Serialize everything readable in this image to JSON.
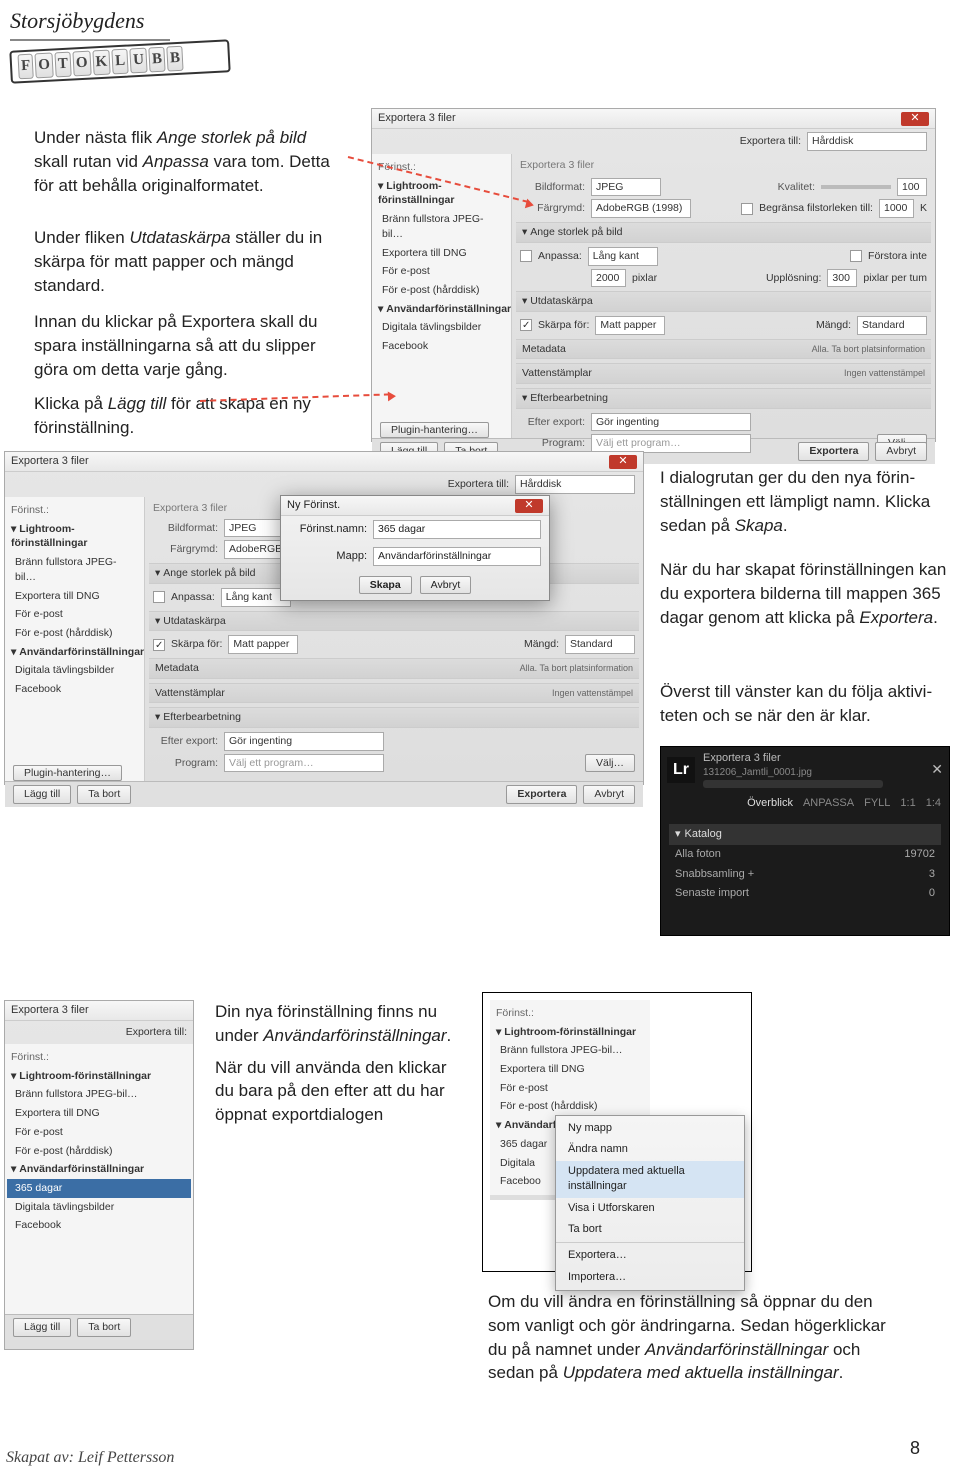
{
  "logo": {
    "name": "Storsjöbygdens",
    "sub": "FOTOKLUBB"
  },
  "para1_l1": "Under nästa flik ",
  "para1_i1": "Ange storlek på bild",
  "para1_l2": " skall rutan vid ",
  "para1_i2": "Anpassa",
  "para1_l3": " vara tom. Detta för att behålla originalforma­tet.",
  "para2_l1": "Under fliken ",
  "para2_i1": "Utdataskärpa",
  "para2_l2": " ställer du in skärpa för matt papper och mängd standard.",
  "para3": "Innan du klickar på Exportera skall du spara inställningarna så att du slipper göra om detta varje gång.",
  "para4_l1": "Klicka på ",
  "para4_i1": "Lägg till",
  "para4_l2": " för att skapa en ny förinställning.",
  "para5_l1": "I dialogrutan ger du den nya förin­ställningen ett lämpligt namn. Klicka sedan på ",
  "para5_i1": "Skapa",
  "para5_l2": ".",
  "para6_l1": "När du har skapat förinställningen kan du exportera bilderna till map­pen 365 dagar genom att klicka på ",
  "para6_i1": "Exportera",
  "para6_l2": ".",
  "para7": "Överst till vänster kan du följa aktivi­teten och se när den är klar.",
  "para8_l1": "Din nya förinställning finns nu under ",
  "para8_i1": "Användarförin­ställningar",
  "para8_l2": ".",
  "para8_l3": "När du vill använda den klickar du bara på den efter att du har öppnat export­dialogen",
  "para9_l1": "Om du vill ändra en förinställning så öppnar du den som vanligt och gör ändringarna. Sedan hö­gerklickar du på namnet under ",
  "para9_i1": "Användarförin­ställningar",
  "para9_l2": " och sedan på ",
  "para9_i2": "Uppdatera med aktuella inställningar",
  "para9_l3": ".",
  "footer": "Skapat av: Leif Pettersson",
  "page": "8",
  "dlg": {
    "title": "Exportera 3 filer",
    "export_to_label": "Exportera till:",
    "export_to": "Hårddisk",
    "preset_label": "Förinst.:",
    "crumb": "Exportera 3 filer",
    "presets": {
      "hdr1": "Lightroom-förinställningar",
      "i1": "Bränn fullstora JPEG-bil…",
      "i2": "Exportera till DNG",
      "i3": "För e-post",
      "i4": "För e-post (hårddisk)",
      "hdr2": "Användarförinställningar",
      "i5": "Digitala tävlingsbilder",
      "i6": "Facebook",
      "i7": "365 dagar"
    },
    "right": {
      "bildformat_l": "Bildformat:",
      "bildformat": "JPEG",
      "kvalitet_l": "Kvalitet:",
      "kvalitet": "100",
      "farg_l": "Färgrymd:",
      "farg": "AdobeRGB (1998)",
      "limit_l": "Begränsa filstorleken till:",
      "limit": "1000",
      "limit_u": "K",
      "sect_size": "Ange storlek på bild",
      "anpassa_l": "Anpassa:",
      "anpassa": "Lång kant",
      "forstora": "Förstora inte",
      "dims": "2000",
      "dims_u": "pixlar",
      "uppl_l": "Upplösning:",
      "uppl": "300",
      "uppl_u": "pixlar per tum",
      "sect_sharp": "Utdataskärpa",
      "skarpfor_l": "Skärpa för:",
      "skarpfor": "Matt papper",
      "mangd_l": "Mängd:",
      "mangd": "Standard",
      "sect_meta": "Metadata",
      "meta_r": "Alla. Ta bort platsinformation",
      "sect_wm": "Vattenstämplar",
      "wm_r": "Ingen vattenstämpel",
      "sect_after": "Efterbearbetning",
      "after_l": "Efter export:",
      "after": "Gör ingenting",
      "prog_l": "Program:",
      "prog": "Välj ett program…",
      "valj": "Välj…"
    },
    "btn_add": "Lägg till",
    "btn_remove": "Ta bort",
    "btn_plugin": "Plugin-hantering…",
    "btn_export": "Exportera",
    "btn_cancel": "Avbryt"
  },
  "modal": {
    "title": "Ny Förinst.",
    "name_l": "Förinst.namn:",
    "name": "365 dagar",
    "folder_l": "Mapp:",
    "folder": "Användarförinställningar",
    "btn_create": "Skapa",
    "btn_cancel": "Avbryt"
  },
  "dark": {
    "title": "Exportera 3 filer",
    "file": "131206_Jamtli_0001.jpg",
    "over": "Överblick",
    "tabs": {
      "a": "ANPASSA",
      "f": "FYLL",
      "o": "1:1",
      "h": "1:4"
    },
    "kat": "Katalog",
    "rows": {
      "alla": "Alla foton",
      "alla_n": "19702",
      "snabb": "Snabbsamling +",
      "snabb_n": "3",
      "sen": "Senaste import",
      "sen_n": "0"
    }
  },
  "ctx": {
    "m1": "Ny mapp",
    "m2": "Ändra namn",
    "m3": "Uppdatera med aktuella inställningar",
    "m4": "Visa i Utforskaren",
    "m5": "Ta bort",
    "m6": "Exportera…",
    "m7": "Importera…"
  }
}
